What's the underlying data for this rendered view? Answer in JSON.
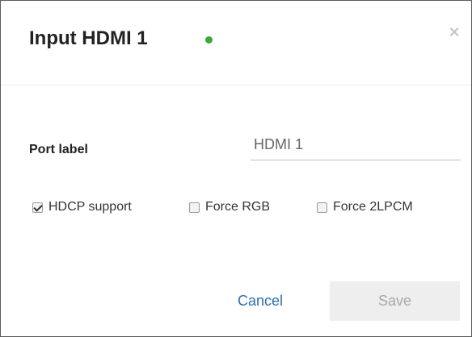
{
  "dialog": {
    "title": "Input HDMI 1",
    "status_color": "#3aaa35",
    "close_icon": "close-icon",
    "close_glyph": "×"
  },
  "form": {
    "port_label": {
      "label": "Port label",
      "value": "HDMI 1"
    },
    "checkboxes": [
      {
        "label": "HDCP support",
        "checked": true
      },
      {
        "label": "Force RGB",
        "checked": false
      },
      {
        "label": "Force 2LPCM",
        "checked": false
      }
    ]
  },
  "actions": {
    "cancel_label": "Cancel",
    "save_label": "Save",
    "save_enabled": false,
    "cancel_color": "#2a6fb0"
  }
}
